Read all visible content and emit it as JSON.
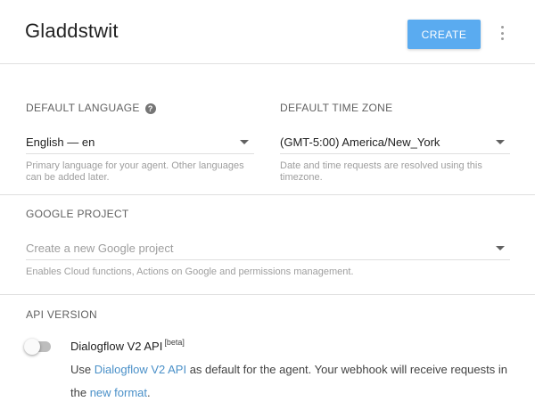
{
  "header": {
    "agent_name": "Gladdstwit",
    "create_label": "CREATE"
  },
  "language": {
    "label": "DEFAULT LANGUAGE",
    "value": "English — en",
    "hint": "Primary language for your agent. Other languages can be added later."
  },
  "timezone": {
    "label": "DEFAULT TIME ZONE",
    "value": "(GMT-5:00) America/New_York",
    "hint": "Date and time requests are resolved using this timezone."
  },
  "google_project": {
    "label": "GOOGLE PROJECT",
    "placeholder": "Create a new Google project",
    "hint": "Enables Cloud functions, Actions on Google and permissions management."
  },
  "api_version": {
    "label": "API VERSION",
    "toggle_on": false,
    "title": "Dialogflow V2 API",
    "badge": "[beta]",
    "desc_prefix": "Use ",
    "desc_link": "Dialogflow V2 API",
    "desc_middle": " as default for the agent. Your webhook will receive requests in the ",
    "desc_link2": "new format",
    "desc_suffix": "."
  },
  "colors": {
    "accent": "#5aabf0",
    "link": "#4a90c8"
  }
}
